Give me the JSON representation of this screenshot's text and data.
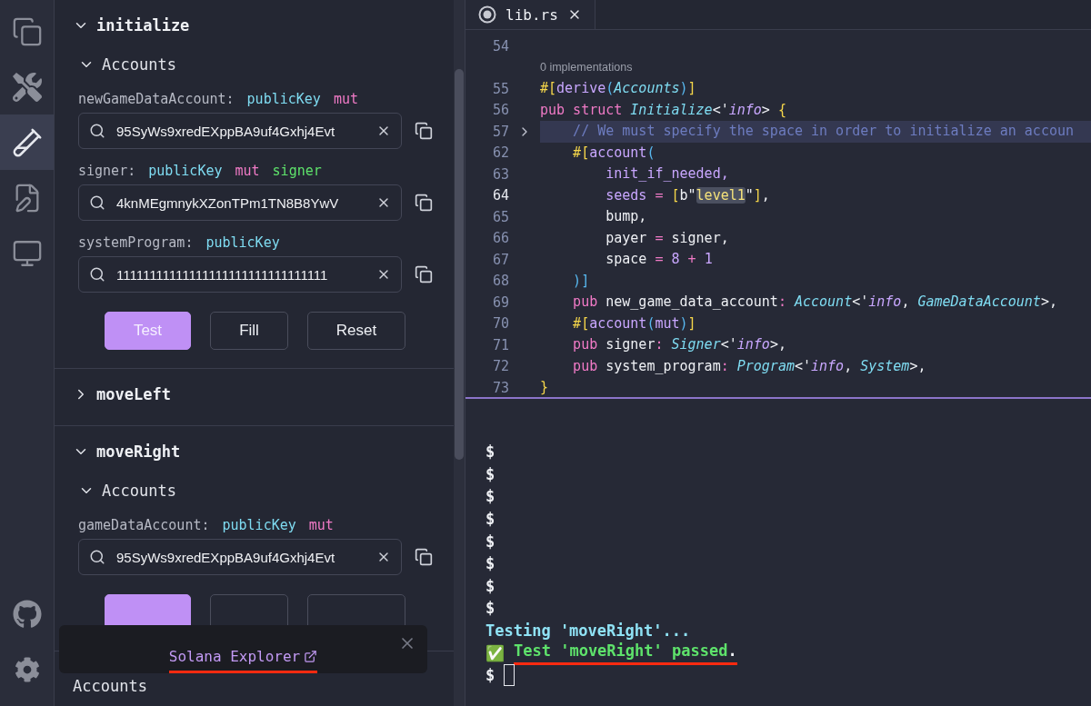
{
  "activity_bar": {
    "top": [
      {
        "kind": "files",
        "selected": false
      },
      {
        "kind": "tools",
        "selected": false
      },
      {
        "kind": "test",
        "selected": true
      },
      {
        "kind": "edit",
        "selected": false
      },
      {
        "kind": "monitor",
        "selected": false
      }
    ],
    "bottom": [
      {
        "kind": "github",
        "selected": false
      },
      {
        "kind": "settings",
        "selected": false
      }
    ]
  },
  "instructions": [
    {
      "name": "initialize",
      "expanded": true,
      "accounts": {
        "label": "Accounts",
        "expanded": true,
        "items": [
          {
            "name": "newGameDataAccount:",
            "tags": [
              {
                "text": "publicKey",
                "kind": "type"
              },
              {
                "text": "mut",
                "kind": "mut"
              }
            ],
            "value": "95SyWs9xredEXppBA9uf4Gxhj4Evt"
          },
          {
            "name": "signer:",
            "tags": [
              {
                "text": "publicKey",
                "kind": "type"
              },
              {
                "text": "mut",
                "kind": "mut"
              },
              {
                "text": "signer",
                "kind": "signer"
              }
            ],
            "value": "4knMEgmnykXZonTPm1TN8B8YwV"
          },
          {
            "name": "systemProgram:",
            "tags": [
              {
                "text": "publicKey",
                "kind": "type"
              }
            ],
            "value": "11111111111111111111111111111111"
          }
        ]
      },
      "buttons": [
        {
          "kind": "primary",
          "label": "Test"
        },
        {
          "kind": "plain",
          "label": "Fill"
        },
        {
          "kind": "plain",
          "label": "Reset"
        }
      ]
    },
    {
      "name": "moveLeft",
      "expanded": false
    },
    {
      "name": "moveRight",
      "expanded": true,
      "accounts": {
        "label": "Accounts",
        "expanded": true,
        "items": [
          {
            "name": "gameDataAccount:",
            "tags": [
              {
                "text": "publicKey",
                "kind": "type"
              },
              {
                "text": "mut",
                "kind": "mut"
              }
            ],
            "value": "95SyWs9xredEXppBA9uf4Gxhj4Evt"
          }
        ]
      },
      "buttons": [
        {
          "kind": "primary"
        },
        {
          "kind": "plain"
        },
        {
          "kind": "plain"
        }
      ]
    }
  ],
  "next_section": {
    "accounts_label": "Accounts"
  },
  "toast": {
    "link": "Solana Explorer",
    "underlined": true
  },
  "editor": {
    "tab": {
      "title": "lib.rs"
    },
    "lines": [
      {
        "number": "54"
      },
      {
        "codelens": "0 implementations"
      },
      {
        "number": "55",
        "tokens": [
          {
            "text": "#[",
            "kind": "macro"
          },
          {
            "text": "derive",
            "kind": "attr"
          },
          {
            "text": "(",
            "kind": "paren"
          },
          {
            "text": "Accounts",
            "kind": "type"
          },
          {
            "text": ")",
            "kind": "paren"
          },
          {
            "text": "]",
            "kind": "macro"
          }
        ]
      },
      {
        "number": "56",
        "tokens": [
          {
            "text": "pub struct ",
            "kind": "kw"
          },
          {
            "text": "Initialize",
            "kind": "type"
          },
          {
            "text": "<'",
            "kind": "plain"
          },
          {
            "text": "info",
            "kind": "life"
          },
          {
            "text": "> ",
            "kind": "plain"
          },
          {
            "text": "{",
            "kind": "macro"
          }
        ]
      },
      {
        "number": "57",
        "folded": true,
        "tokens": [
          {
            "text": "    // We must specify the space in order to initialize an accoun",
            "kind": "comment"
          }
        ]
      },
      {
        "number": "62",
        "tokens": [
          {
            "text": "    #[",
            "kind": "macro"
          },
          {
            "text": "account",
            "kind": "attr"
          },
          {
            "text": "(",
            "kind": "paren"
          }
        ]
      },
      {
        "number": "63",
        "tokens": [
          {
            "text": "        init_if_needed,",
            "kind": "attr"
          }
        ]
      },
      {
        "number": "64",
        "current": true,
        "tokens": [
          {
            "text": "        seeds ",
            "kind": "attr"
          },
          {
            "text": "= ",
            "kind": "kw"
          },
          {
            "text": "[",
            "kind": "macro"
          },
          {
            "text": "b\"",
            "kind": "plain"
          },
          {
            "text": "level1",
            "kind": "match"
          },
          {
            "text": "\"",
            "kind": "plain"
          },
          {
            "text": "]",
            "kind": "macro"
          },
          {
            "text": ",",
            "kind": "plain"
          }
        ]
      },
      {
        "number": "65",
        "tokens": [
          {
            "text": "        bump,",
            "kind": "plain"
          }
        ]
      },
      {
        "number": "66",
        "tokens": [
          {
            "text": "        payer ",
            "kind": "plain"
          },
          {
            "text": "= ",
            "kind": "kw"
          },
          {
            "text": "signer,",
            "kind": "plain"
          }
        ]
      },
      {
        "number": "67",
        "tokens": [
          {
            "text": "        space ",
            "kind": "plain"
          },
          {
            "text": "= ",
            "kind": "kw"
          },
          {
            "text": "8 ",
            "kind": "num"
          },
          {
            "text": "+ ",
            "kind": "kw"
          },
          {
            "text": "1",
            "kind": "num"
          }
        ]
      },
      {
        "number": "68",
        "tokens": [
          {
            "text": "    )",
            "kind": "paren"
          },
          {
            "text": "]",
            "kind": "paren"
          }
        ]
      },
      {
        "number": "69",
        "tokens": [
          {
            "text": "    pub ",
            "kind": "kw"
          },
          {
            "text": "new_game_data_account",
            "kind": "plain"
          },
          {
            "text": ": ",
            "kind": "kw"
          },
          {
            "text": "Account",
            "kind": "type"
          },
          {
            "text": "<'",
            "kind": "plain"
          },
          {
            "text": "info",
            "kind": "life"
          },
          {
            "text": ", ",
            "kind": "plain"
          },
          {
            "text": "GameDataAccount",
            "kind": "type"
          },
          {
            "text": ">,",
            "kind": "plain"
          }
        ]
      },
      {
        "number": "70",
        "tokens": [
          {
            "text": "    #[",
            "kind": "macro"
          },
          {
            "text": "account",
            "kind": "attr"
          },
          {
            "text": "(",
            "kind": "paren"
          },
          {
            "text": "mut",
            "kind": "attr"
          },
          {
            "text": ")",
            "kind": "paren"
          },
          {
            "text": "]",
            "kind": "macro"
          }
        ]
      },
      {
        "number": "71",
        "tokens": [
          {
            "text": "    pub ",
            "kind": "kw"
          },
          {
            "text": "signer",
            "kind": "plain"
          },
          {
            "text": ": ",
            "kind": "kw"
          },
          {
            "text": "Signer",
            "kind": "type"
          },
          {
            "text": "<'",
            "kind": "plain"
          },
          {
            "text": "info",
            "kind": "life"
          },
          {
            "text": ">,",
            "kind": "plain"
          }
        ]
      },
      {
        "number": "72",
        "tokens": [
          {
            "text": "    pub ",
            "kind": "kw"
          },
          {
            "text": "system_program",
            "kind": "plain"
          },
          {
            "text": ": ",
            "kind": "kw"
          },
          {
            "text": "Program",
            "kind": "type"
          },
          {
            "text": "<'",
            "kind": "plain"
          },
          {
            "text": "info",
            "kind": "life"
          },
          {
            "text": ", ",
            "kind": "plain"
          },
          {
            "text": "System",
            "kind": "type"
          },
          {
            "text": ">,",
            "kind": "plain"
          }
        ]
      },
      {
        "number": "73",
        "tokens": [
          {
            "text": "}",
            "kind": "macro"
          }
        ]
      }
    ]
  },
  "terminal": {
    "lines": [
      {
        "kind": "prompt",
        "text": "$"
      },
      {
        "kind": "prompt",
        "text": "$"
      },
      {
        "kind": "prompt",
        "text": "$"
      },
      {
        "kind": "prompt",
        "text": "$"
      },
      {
        "kind": "prompt",
        "text": "$"
      },
      {
        "kind": "prompt",
        "text": "$"
      },
      {
        "kind": "prompt",
        "text": "$"
      },
      {
        "kind": "prompt",
        "text": "$"
      },
      {
        "kind": "info",
        "text": "Testing 'moveRight'..."
      },
      {
        "kind": "success",
        "icon": "✅",
        "text": "Test 'moveRight' passed",
        "tail": ".",
        "underlined": true
      },
      {
        "kind": "input",
        "text": "$"
      }
    ]
  }
}
